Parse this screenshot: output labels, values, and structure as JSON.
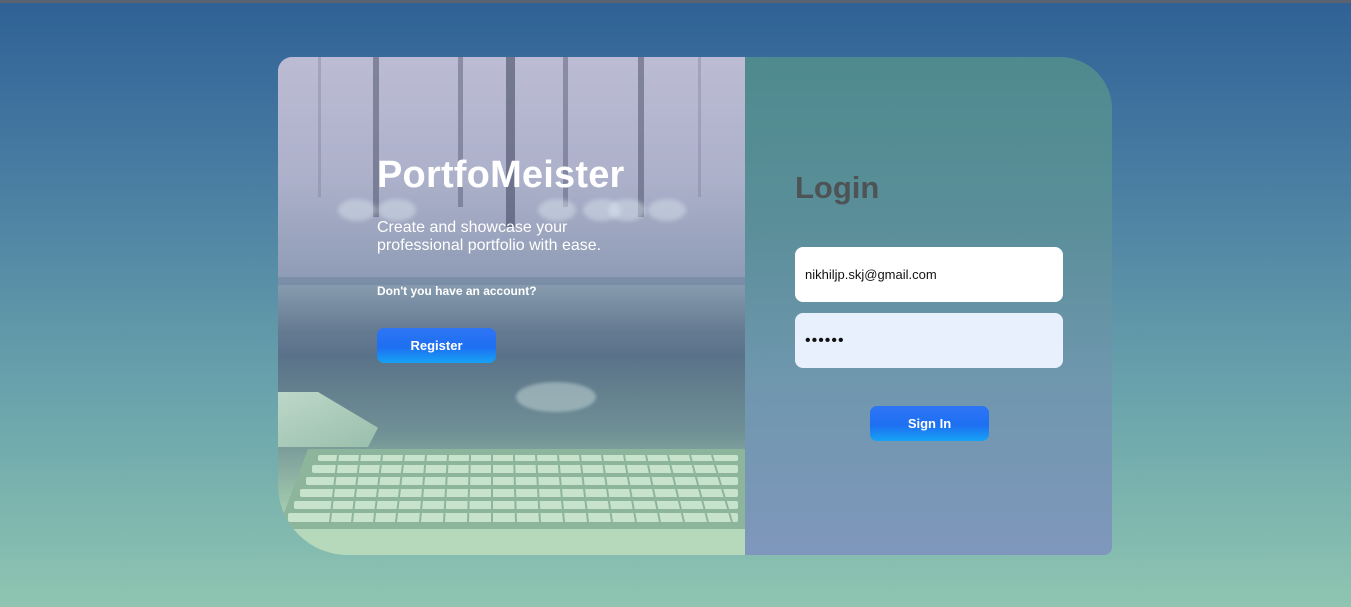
{
  "brand": {
    "title": "PortfoMeister",
    "tagline": "Create and showcase your professional portfolio with ease.",
    "question": "Don't you have an account?",
    "register_label": "Register"
  },
  "login": {
    "title": "Login",
    "email_value": "nikhiljp.skj@gmail.com",
    "password_value": "••••••",
    "signin_label": "Sign In"
  },
  "colors": {
    "button_gradient_top": "#2e75f5",
    "button_gradient_bottom": "#16a3f4",
    "login_title": "#4e5356",
    "password_bg": "#e8f0fe"
  }
}
